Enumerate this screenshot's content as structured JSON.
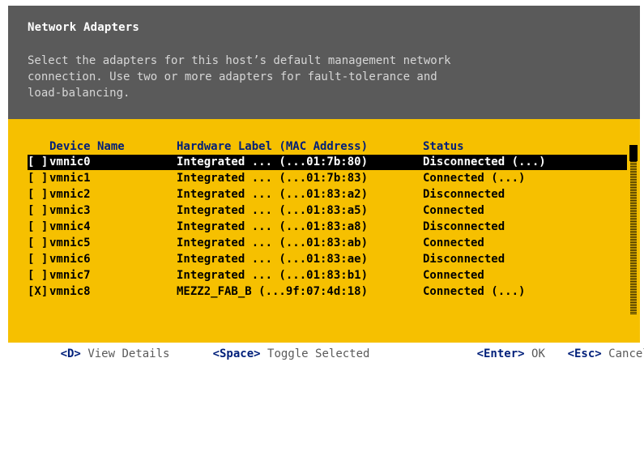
{
  "header": {
    "title": "Network Adapters",
    "description": "Select the adapters for this host’s default management network\nconnection. Use two or more adapters for fault-tolerance and\nload-balancing."
  },
  "table": {
    "columns": {
      "device": "Device Name",
      "hardware": "Hardware Label (MAC Address)",
      "status": "Status"
    },
    "rows": [
      {
        "check": "[ ]",
        "device": "vmnic0",
        "hardware": "Integrated ... (...01:7b:80)",
        "status": "Disconnected (...)",
        "selected": true
      },
      {
        "check": "[ ]",
        "device": "vmnic1",
        "hardware": "Integrated ... (...01:7b:83)",
        "status": "Connected (...)",
        "selected": false
      },
      {
        "check": "[ ]",
        "device": "vmnic2",
        "hardware": "Integrated ... (...01:83:a2)",
        "status": "Disconnected",
        "selected": false
      },
      {
        "check": "[ ]",
        "device": "vmnic3",
        "hardware": "Integrated ... (...01:83:a5)",
        "status": "Connected",
        "selected": false
      },
      {
        "check": "[ ]",
        "device": "vmnic4",
        "hardware": "Integrated ... (...01:83:a8)",
        "status": "Disconnected",
        "selected": false
      },
      {
        "check": "[ ]",
        "device": "vmnic5",
        "hardware": "Integrated ... (...01:83:ab)",
        "status": "Connected",
        "selected": false
      },
      {
        "check": "[ ]",
        "device": "vmnic6",
        "hardware": "Integrated ... (...01:83:ae)",
        "status": "Disconnected",
        "selected": false
      },
      {
        "check": "[ ]",
        "device": "vmnic7",
        "hardware": "Integrated ... (...01:83:b1)",
        "status": "Connected",
        "selected": false
      },
      {
        "check": "[X]",
        "device": "vmnic8",
        "hardware": "MEZZ2_FAB_B (...9f:07:4d:18)",
        "status": "Connected (...)",
        "selected": false
      }
    ]
  },
  "footer": {
    "view_key": "<D>",
    "view_label": "View Details",
    "toggle_key": "<Space>",
    "toggle_label": "Toggle Selected",
    "ok_key": "<Enter>",
    "ok_label": "OK",
    "cancel_key": "<Esc>",
    "cancel_label": "Cancel"
  },
  "colors": {
    "header_bg": "#5a5a5a",
    "body_bg": "#f6c000",
    "selected_row_bg": "#000000",
    "header_text": "#001f7a"
  }
}
